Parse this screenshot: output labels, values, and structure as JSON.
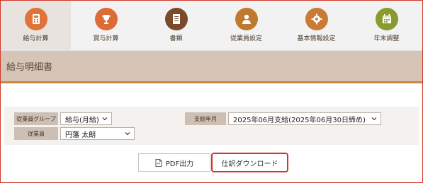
{
  "tabs": [
    {
      "label": "給与計算",
      "icon": "payroll-icon",
      "color": "#e0733a",
      "active": true
    },
    {
      "label": "賞与計算",
      "icon": "trophy-icon",
      "color": "#de6a35",
      "active": false
    },
    {
      "label": "書類",
      "icon": "document-icon",
      "color": "#7a4a2a",
      "active": false
    },
    {
      "label": "従業員設定",
      "icon": "person-icon",
      "color": "#c07a2e",
      "active": false
    },
    {
      "label": "基本情報設定",
      "icon": "gear-icon",
      "color": "#c97a34",
      "active": false
    },
    {
      "label": "年末調整",
      "icon": "calendar-icon",
      "color": "#8a9a2e",
      "active": false
    }
  ],
  "header": {
    "title": "給与明細書"
  },
  "filters": {
    "group_label": "従業員グループ",
    "group_value": "給与(月給)",
    "employee_label": "従業員",
    "employee_value": "円藩 太朗",
    "period_label": "支給年月",
    "period_value": "2025年06月支給(2025年06月30日締め)"
  },
  "actions": {
    "pdf_label": "PDF出力",
    "journal_label": "仕訳ダウンロード"
  },
  "colors": {
    "accent": "#c8853c",
    "header_bg": "#d6c5b6",
    "highlight": "#d0342c"
  }
}
